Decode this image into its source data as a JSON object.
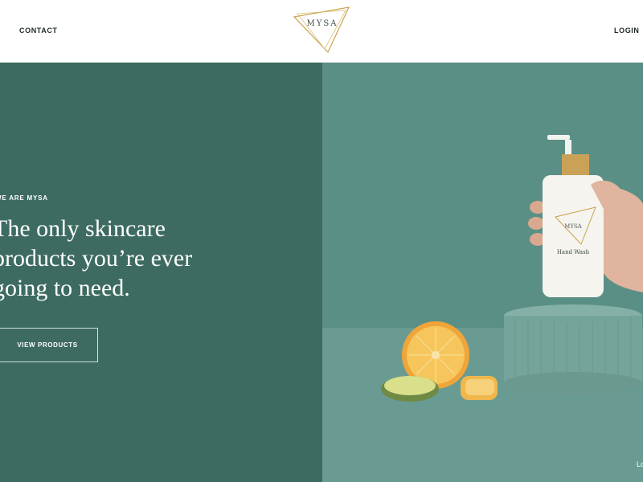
{
  "nav": {
    "contact_label": "CONTACT",
    "login_label": "LOGIN",
    "brand": "MYSA"
  },
  "hero": {
    "eyebrow": "WE ARE MYSA",
    "headline_lines": [
      "The only skincare",
      "products you’re ever",
      "going to need."
    ],
    "cta_label": "VIEW PRODUCTS",
    "image_caption": "Lo",
    "product_brand": "MYSA",
    "product_name": "Hand Wash"
  },
  "colors": {
    "hero_left": "#3d6b61",
    "hero_right": "#5a8f86",
    "logo_gold": "#c9a24a"
  }
}
